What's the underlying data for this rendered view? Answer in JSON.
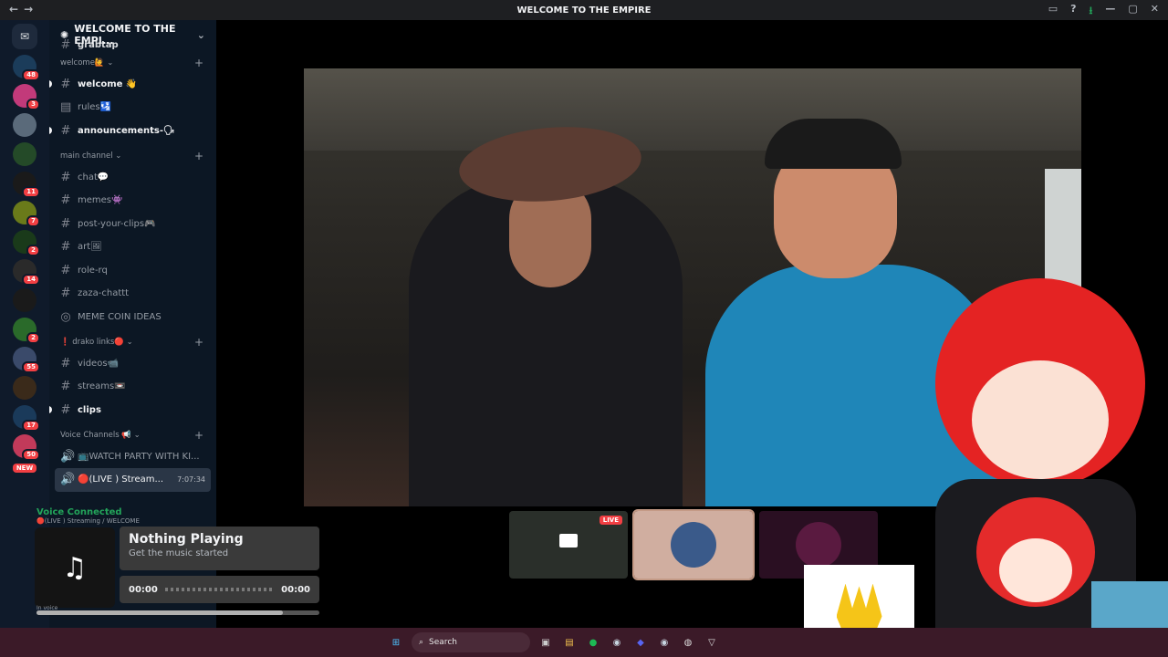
{
  "window": {
    "title": "WELCOME TO THE EMPIRE",
    "nav_back": "←",
    "nav_forward": "→",
    "controls": [
      "▭",
      "?",
      "⭳",
      "—",
      "▢",
      "✕"
    ]
  },
  "servers": {
    "home_icon": "discord-icon",
    "items": [
      {
        "badge": "48",
        "color": "#1b3c5a"
      },
      {
        "badge": "3",
        "color": "#c23a7a"
      },
      {
        "badge": "",
        "color": "#5a6a7a"
      },
      {
        "badge": "",
        "color": "#244a28"
      },
      {
        "badge": "11",
        "color": "#1a1a1a"
      },
      {
        "badge": "7",
        "color": "#6a7a1a"
      },
      {
        "badge": "2",
        "color": "#1a3a1a"
      },
      {
        "badge": "14",
        "color": "#2a2a2a"
      },
      {
        "badge": "",
        "color": "#1a1a1a"
      },
      {
        "badge": "2",
        "color": "#2a6a2a"
      },
      {
        "badge": "55",
        "color": "#3a4a6a"
      },
      {
        "badge": "",
        "color": "#3a2a1a"
      },
      {
        "badge": "17",
        "color": "#1a3a5a"
      },
      {
        "badge": "50",
        "color": "#c23a5a"
      }
    ],
    "new_label": "NEW"
  },
  "guild": {
    "name": "WELCOME TO THE EMPI...",
    "top_partial": "grabtap"
  },
  "channels": [
    {
      "type": "cat",
      "label": "welcome🙋 ⌄"
    },
    {
      "type": "text",
      "label": "welcome 👋",
      "bold": true,
      "dot": true
    },
    {
      "type": "rules",
      "label": "rules🛂"
    },
    {
      "type": "text",
      "label": "announcements-🗣",
      "bold": true,
      "dot": true
    },
    {
      "type": "cat",
      "label": "main channel ⌄"
    },
    {
      "type": "text",
      "label": "chat💬"
    },
    {
      "type": "text",
      "label": "memes👾"
    },
    {
      "type": "text",
      "label": "post-your-clips🎮"
    },
    {
      "type": "text",
      "label": "art🖼"
    },
    {
      "type": "text",
      "label": "role-rq"
    },
    {
      "type": "text",
      "label": "zaza-chattt"
    },
    {
      "type": "forum",
      "label": "MEME COIN IDEAS"
    },
    {
      "type": "cat",
      "label": "❗ drako links🔴 ⌄"
    },
    {
      "type": "text",
      "label": "videos📹"
    },
    {
      "type": "text",
      "label": "streams📼"
    },
    {
      "type": "text",
      "label": "clips",
      "bold": true,
      "dot": true
    },
    {
      "type": "cat",
      "label": "Voice Channels 📢 ⌄"
    },
    {
      "type": "voice",
      "label": "📺WATCH PARTY WITH KI..."
    },
    {
      "type": "voice",
      "label": "🔴(LIVE ) Stream...",
      "active": true,
      "time": "7:07:34"
    }
  ],
  "voice": {
    "status": "Voice Connected",
    "sub": "🔴(LIVE ) Streaming / WELCOME",
    "in_voice": "In voice"
  },
  "player": {
    "icon": "♫",
    "title": "Nothing Playing",
    "subtitle": "Get the music started",
    "time_start": "00:00",
    "time_end": "00:00",
    "progress": 0.87
  },
  "stream": {
    "live_label": "LIVE"
  },
  "taskbar": {
    "search_placeholder": "Search",
    "icons": [
      "file-explorer-icon",
      "folder-icon",
      "spotify-icon",
      "steam-icon",
      "discord-icon",
      "steam-icon",
      "chrome-icon",
      "app-icon"
    ]
  }
}
